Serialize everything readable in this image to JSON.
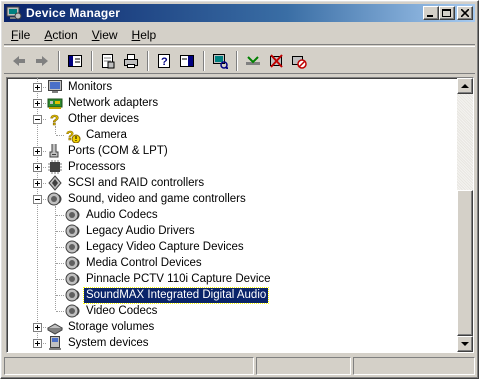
{
  "window": {
    "title": "Device Manager",
    "icon": "device-manager-icon"
  },
  "titlebar_buttons": [
    "minimize",
    "maximize",
    "close"
  ],
  "menu": {
    "items": [
      {
        "label": "File",
        "accel": "F",
        "rest": "ile"
      },
      {
        "label": "Action",
        "accel": "A",
        "rest": "ction"
      },
      {
        "label": "View",
        "accel": "V",
        "rest": "iew"
      },
      {
        "label": "Help",
        "accel": "H",
        "rest": "elp"
      }
    ]
  },
  "toolbar": {
    "buttons": [
      "back-icon",
      "forward-icon",
      "show-hide-tree-icon",
      "properties-icon",
      "print-icon",
      "help-icon",
      "show-hide-action-pane-icon",
      "scan-hardware-icon",
      "update-driver-icon",
      "uninstall-icon",
      "disable-icon"
    ]
  },
  "tree": {
    "items": [
      {
        "label": "Monitors",
        "level": 0,
        "expander": "plus",
        "icon": "monitor-icon"
      },
      {
        "label": "Network adapters",
        "level": 0,
        "expander": "plus",
        "icon": "network-adapter-icon"
      },
      {
        "label": "Other devices",
        "level": 0,
        "expander": "minus",
        "icon": "unknown-device-icon"
      },
      {
        "label": "Camera",
        "level": 1,
        "expander": "none",
        "icon": "warning-device-icon"
      },
      {
        "label": "Ports (COM & LPT)",
        "level": 0,
        "expander": "plus",
        "icon": "port-icon"
      },
      {
        "label": "Processors",
        "level": 0,
        "expander": "plus",
        "icon": "processor-icon"
      },
      {
        "label": "SCSI and RAID controllers",
        "level": 0,
        "expander": "plus",
        "icon": "scsi-icon"
      },
      {
        "label": "Sound, video and game controllers",
        "level": 0,
        "expander": "minus",
        "icon": "sound-icon"
      },
      {
        "label": "Audio Codecs",
        "level": 1,
        "expander": "none",
        "icon": "sound-icon"
      },
      {
        "label": "Legacy Audio Drivers",
        "level": 1,
        "expander": "none",
        "icon": "sound-icon"
      },
      {
        "label": "Legacy Video Capture Devices",
        "level": 1,
        "expander": "none",
        "icon": "sound-icon"
      },
      {
        "label": "Media Control Devices",
        "level": 1,
        "expander": "none",
        "icon": "sound-icon"
      },
      {
        "label": "Pinnacle PCTV 110i Capture Device",
        "level": 1,
        "expander": "none",
        "icon": "sound-icon"
      },
      {
        "label": "SoundMAX Integrated Digital Audio",
        "level": 1,
        "expander": "none",
        "icon": "sound-icon",
        "selected": true
      },
      {
        "label": "Video Codecs",
        "level": 1,
        "expander": "none",
        "icon": "sound-icon"
      },
      {
        "label": "Storage volumes",
        "level": 0,
        "expander": "plus",
        "icon": "storage-icon"
      },
      {
        "label": "System devices",
        "level": 0,
        "expander": "plus",
        "icon": "system-icon"
      }
    ]
  },
  "colors": {
    "selection": "#0a246a",
    "titlebar_start": "#0a246a",
    "face": "#d4d0c8"
  }
}
